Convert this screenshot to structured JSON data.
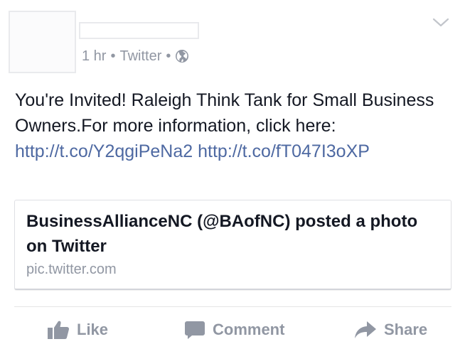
{
  "post": {
    "time": "1 hr",
    "separator": "•",
    "source": "Twitter",
    "privacy_icon": "globe-icon",
    "menu_icon": "chevron-down-icon",
    "message": {
      "text": "You're Invited! Raleigh Think Tank for Small Business Owners.For more information, click here: ",
      "link1": "http://t.co/Y2qgiPeNa2",
      "link2": "http://t.co/fT047I3oXP"
    },
    "attachment": {
      "title": "BusinessAllianceNC (@BAofNC) posted a photo on Twitter",
      "source": "pic.twitter.com"
    },
    "actions": {
      "like": "Like",
      "comment": "Comment",
      "share": "Share"
    }
  },
  "colors": {
    "text": "#141823",
    "meta": "#9197a3",
    "link": "#4e69a2",
    "border": "#e9eaed"
  }
}
